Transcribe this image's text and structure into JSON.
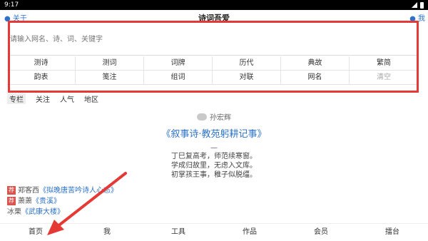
{
  "status": {
    "time": "9:17"
  },
  "appbar": {
    "back": "关于",
    "title": "诗词吾爱",
    "right": "我"
  },
  "search": {
    "placeholder": "请输入网名、诗、词、关键字"
  },
  "grid": [
    "测诗",
    "测词",
    "词牌",
    "历代",
    "典故",
    "繁简",
    "韵表",
    "笺注",
    "组词",
    "对联",
    "网名",
    "清空"
  ],
  "tabs": [
    "专栏",
    "关注",
    "人气",
    "地区"
  ],
  "poem": {
    "author": "孙宏辉",
    "title": "《叙事诗·教苑躬耕记事》",
    "dash": "—",
    "lines": [
      "丁巳复高考，师范续寒窗。",
      "学成归故里，无虑入文库。",
      "初掌孩王事，稚子似脱缰。"
    ]
  },
  "recs": [
    {
      "tag": "荐",
      "author": "郑客西",
      "title": "《拟晚唐苦吟诗人心态》"
    },
    {
      "tag": "荐",
      "author": "萧萧",
      "title": "《贵溪》"
    },
    {
      "tag": "",
      "author": "冰栗",
      "title": "《武康大楼》"
    }
  ],
  "bottomnav": [
    "首页",
    "我",
    "工具",
    "作品",
    "会员",
    "擂台"
  ],
  "colors": {
    "accent": "#2e73c8",
    "highlight": "#e53935"
  }
}
